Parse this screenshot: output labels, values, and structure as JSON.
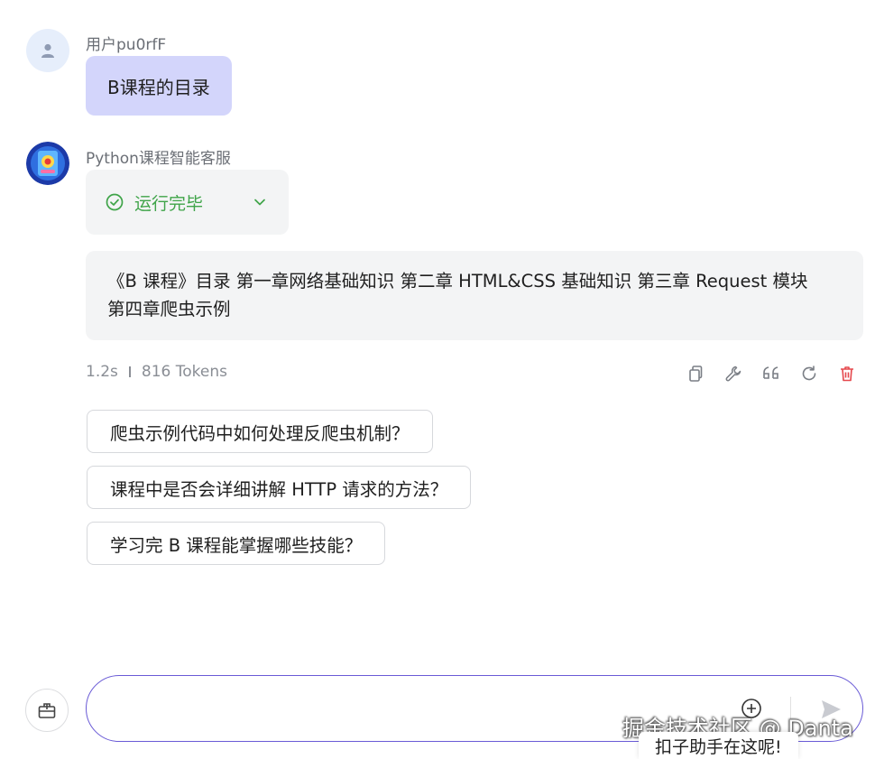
{
  "user_message": {
    "name": "用户pu0rfF",
    "text": "B课程的目录"
  },
  "bot_message": {
    "name": "Python课程智能客服",
    "status": "运行完毕",
    "answer_line1": "《B 课程》目录 第一章网络基础知识 第二章 HTML&CSS 基础知识 第三章 Request 模块",
    "answer_line2": "第四章爬虫示例",
    "time": "1.2s",
    "tokens": "816 Tokens"
  },
  "actions": {
    "icons": [
      "copy-icon",
      "wrench-icon",
      "quote-icon",
      "refresh-icon",
      "trash-icon"
    ],
    "delete_color": "#e5484d"
  },
  "suggestions": [
    "爬虫示例代码中如何处理反爬虫机制？",
    "课程中是否会详细讲解 HTTP 请求的方法？",
    "学习完 B 课程能掌握哪些技能？"
  ],
  "input": {
    "value": "",
    "placeholder": ""
  },
  "overlay": {
    "watermark": "掘金技术社区 @ Danta",
    "tooltip": "扣子助手在这呢!"
  },
  "colors": {
    "accent": "#6a5bd6",
    "user_bubble": "#d3d5fb",
    "status_green": "#3fa449"
  }
}
